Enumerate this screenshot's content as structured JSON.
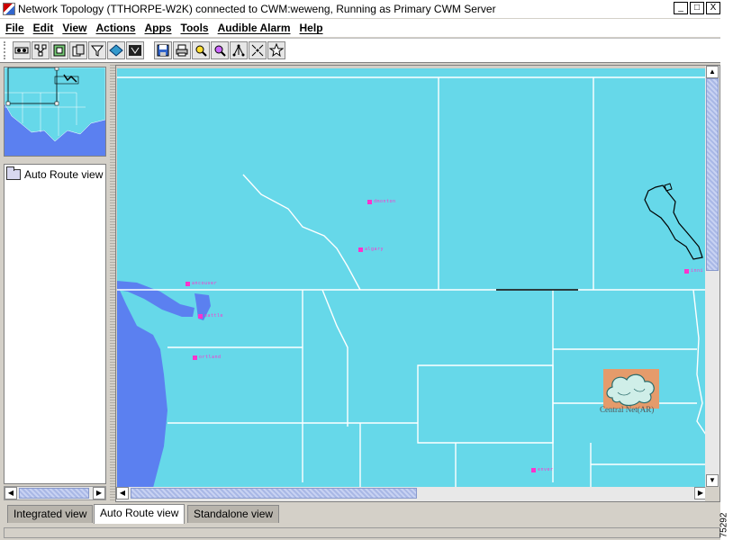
{
  "window": {
    "title": "Network Topology  (TTHORPE-W2K) connected to CWM:weweng, Running as Primary CWM Server",
    "minimize": "_",
    "maximize": "□",
    "close": "X"
  },
  "menu": [
    "File",
    "Edit",
    "View",
    "Actions",
    "Apps",
    "Tools",
    "Audible Alarm",
    "Help"
  ],
  "toolbar": {
    "group1": [
      "connect-icon",
      "network-icon",
      "nodes-icon",
      "copy-icon",
      "filter-icon",
      "layer-icon",
      "sort-icon"
    ],
    "group2": [
      "save-icon",
      "print-icon",
      "zoom-in-icon",
      "zoom-out-icon",
      "layout-icon",
      "fit-icon",
      "pin-icon"
    ]
  },
  "tree": {
    "root_label": "Auto Route view"
  },
  "map": {
    "cities": [
      {
        "name": "edmonton",
        "label": "dmonton"
      },
      {
        "name": "calgary",
        "label": "algary"
      },
      {
        "name": "vancouver",
        "label": "ancouver"
      },
      {
        "name": "seattle",
        "label": "eattle"
      },
      {
        "name": "portland",
        "label": "ortland"
      },
      {
        "name": "winnipeg",
        "label": "inni"
      },
      {
        "name": "denver",
        "label": "enver"
      }
    ],
    "cloud_node": {
      "label": "Central Net(AR)"
    }
  },
  "tabs": [
    {
      "label": "Integrated view",
      "active": false
    },
    {
      "label": "Auto Route view",
      "active": true
    },
    {
      "label": "Standalone view",
      "active": false
    }
  ],
  "figure_code": "75292",
  "colors": {
    "land": "#66d8e9",
    "water": "#5b80f0",
    "border": "#ffffff",
    "city": "#ff33cc",
    "cloud_node_bg": "#e59b6b"
  }
}
